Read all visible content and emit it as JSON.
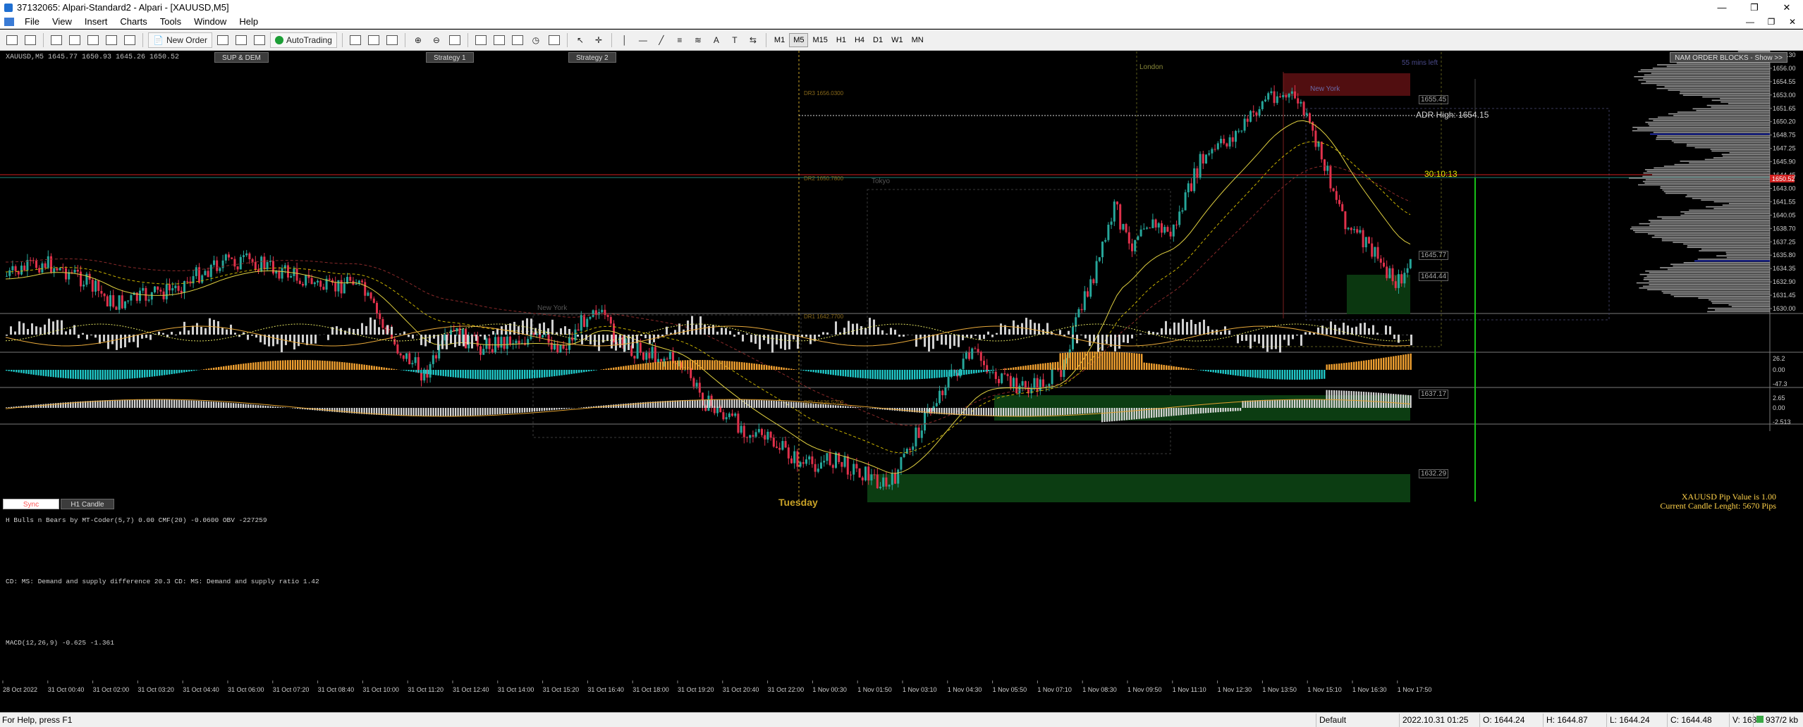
{
  "window": {
    "title": "37132065: Alpari-Standard2 - Alpari - [XAUUSD,M5]",
    "controls": {
      "minimize": "—",
      "maximize": "❐",
      "close": "✕"
    }
  },
  "menu": [
    "File",
    "View",
    "Insert",
    "Charts",
    "Tools",
    "Window",
    "Help"
  ],
  "toolbar": {
    "new_order": "New Order",
    "autotrading": "AutoTrading",
    "timeframes": [
      "M1",
      "M5",
      "M15",
      "H1",
      "H4",
      "D1",
      "W1",
      "MN"
    ],
    "active_timeframe": "M5"
  },
  "chart": {
    "symbol_info": "XAUUSD,M5  1645.77 1650.93 1645.26 1650.52",
    "buttons": {
      "sup_dem": "SUP & DEM",
      "strategy1": "Strategy 1",
      "strategy2": "Strategy 2",
      "order_blocks": "NAM ORDER BLOCKS - Show >>"
    },
    "bottom_buttons": {
      "sync": "Sync",
      "h1": "H1 Candle"
    },
    "day_label": "Tuesday",
    "session_labels": {
      "london": "London",
      "newyork": "New York",
      "newyork_old": "New York",
      "tokyo": "Tokyo"
    },
    "timer": "55 mins left",
    "adr_high": "ADR High: 1654.15",
    "countdown": "30:10:13",
    "level_labels": [
      "DR3 1656.0300",
      "DR2 1650.7800",
      "DR1 1642.7700",
      "DPV 1636.5200"
    ],
    "level_boxes": [
      "1655.45",
      "1645.77",
      "1644.44",
      "1637.17",
      "1632.29"
    ],
    "pip_info": [
      "XAUUSD Pip Value is 1.00",
      "Current Candle Lenght: 5670 Pips"
    ],
    "price_scale": [
      "1658.30",
      "1656.00",
      "1654.55",
      "1653.00",
      "1651.65",
      "1650.20",
      "1648.75",
      "1647.25",
      "1645.90",
      "1644.45",
      "1643.00",
      "1641.55",
      "1640.05",
      "1638.70",
      "1637.25",
      "1635.80",
      "1634.35",
      "1632.90",
      "1631.45",
      "1630.00"
    ],
    "current_price": "1650.52",
    "time_scale": [
      "28 Oct 2022",
      "31 Oct 00:40",
      "31 Oct 02:00",
      "31 Oct 03:20",
      "31 Oct 04:40",
      "31 Oct 06:00",
      "31 Oct 07:20",
      "31 Oct 08:40",
      "31 Oct 10:00",
      "31 Oct 11:20",
      "31 Oct 12:40",
      "31 Oct 14:00",
      "31 Oct 15:20",
      "31 Oct 16:40",
      "31 Oct 18:00",
      "31 Oct 19:20",
      "31 Oct 20:40",
      "31 Oct 22:00",
      "1 Nov 00:30",
      "1 Nov 01:50",
      "1 Nov 03:10",
      "1 Nov 04:30",
      "1 Nov 05:50",
      "1 Nov 07:10",
      "1 Nov 08:30",
      "1 Nov 09:50",
      "1 Nov 11:10",
      "1 Nov 12:30",
      "1 Nov 13:50",
      "1 Nov 15:10",
      "1 Nov 16:30",
      "1 Nov 17:50"
    ]
  },
  "indicators": {
    "ind1": "H Bulls n Bears by MT-Coder(5,7) 0.00  CMF(20) -0.0600  OBV -227259",
    "ind2": "CD: MS: Demand and supply difference  20.3  CD: MS: Demand and supply ratio  1.42",
    "ind2_scale": [
      "26.2",
      "0.00",
      "-47.3"
    ],
    "ind3": "MACD(12,26,9) -0.625 -1.361",
    "ind3_scale": [
      "2.65",
      "0.00",
      "-2.513"
    ]
  },
  "status": {
    "help": "For Help, press F1",
    "profile": "Default",
    "datetime": "2022.10.31 01:25",
    "open": "O: 1644.24",
    "high": "H: 1644.87",
    "low": "L: 1644.24",
    "close": "C: 1644.48",
    "volume": "V: 163",
    "traffic": "937/2 kb"
  },
  "colors": {
    "bull": "#26a69a",
    "bear": "#e0314b",
    "macd": "#d8d8d8",
    "cmf": "#e8a93a",
    "demand_zone": "#0c3d12",
    "supply_zone": "#5a0f12"
  }
}
